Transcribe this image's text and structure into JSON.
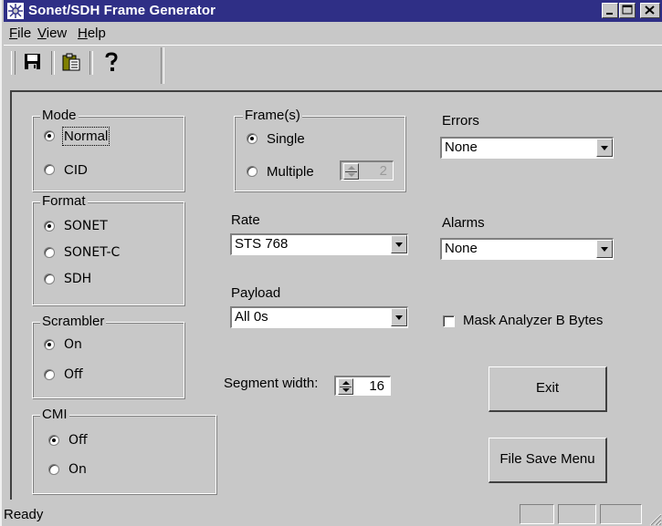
{
  "window": {
    "title": "Sonet/SDH Frame Generator"
  },
  "menu": {
    "items": [
      {
        "label": "File",
        "mnemonic": "F",
        "rest": "ile"
      },
      {
        "label": "View",
        "mnemonic": "V",
        "rest": "iew"
      },
      {
        "label": "Help",
        "mnemonic": "H",
        "rest": "elp"
      }
    ]
  },
  "toolbar": {
    "icons": [
      "save-icon",
      "paste-icon",
      "help-icon"
    ]
  },
  "mode": {
    "label": "Mode",
    "options": [
      {
        "label": "Normal",
        "selected": true
      },
      {
        "label": "CID",
        "selected": false
      }
    ]
  },
  "format": {
    "label": "Format",
    "options": [
      {
        "label": "SONET",
        "selected": true
      },
      {
        "label": "SONET-C",
        "selected": false
      },
      {
        "label": "SDH",
        "selected": false
      }
    ]
  },
  "scrambler": {
    "label": "Scrambler",
    "options": [
      {
        "label": "On",
        "selected": true
      },
      {
        "label": "Off",
        "selected": false
      }
    ]
  },
  "cmi": {
    "label": "CMI",
    "options": [
      {
        "label": "Off",
        "selected": true
      },
      {
        "label": "On",
        "selected": false
      }
    ]
  },
  "frames": {
    "label": "Frame(s)",
    "options": [
      {
        "label": "Single",
        "selected": true
      },
      {
        "label": "Multiple",
        "selected": false
      }
    ],
    "multiple_count": "2"
  },
  "rate": {
    "label": "Rate",
    "value": "STS 768"
  },
  "payload": {
    "label": "Payload",
    "value": "All 0s"
  },
  "segment_width": {
    "label": "Segment width:",
    "value": "16"
  },
  "errors": {
    "label": "Errors",
    "value": "None"
  },
  "alarms": {
    "label": "Alarms",
    "value": "None"
  },
  "mask": {
    "label": "Mask Analyzer B Bytes",
    "checked": false
  },
  "buttons": {
    "exit": "Exit",
    "file_save_menu": "File Save Menu"
  },
  "status": {
    "text": "Ready"
  },
  "colors": {
    "titlebar": "#2f2f86",
    "face": "#c8c8c8"
  }
}
